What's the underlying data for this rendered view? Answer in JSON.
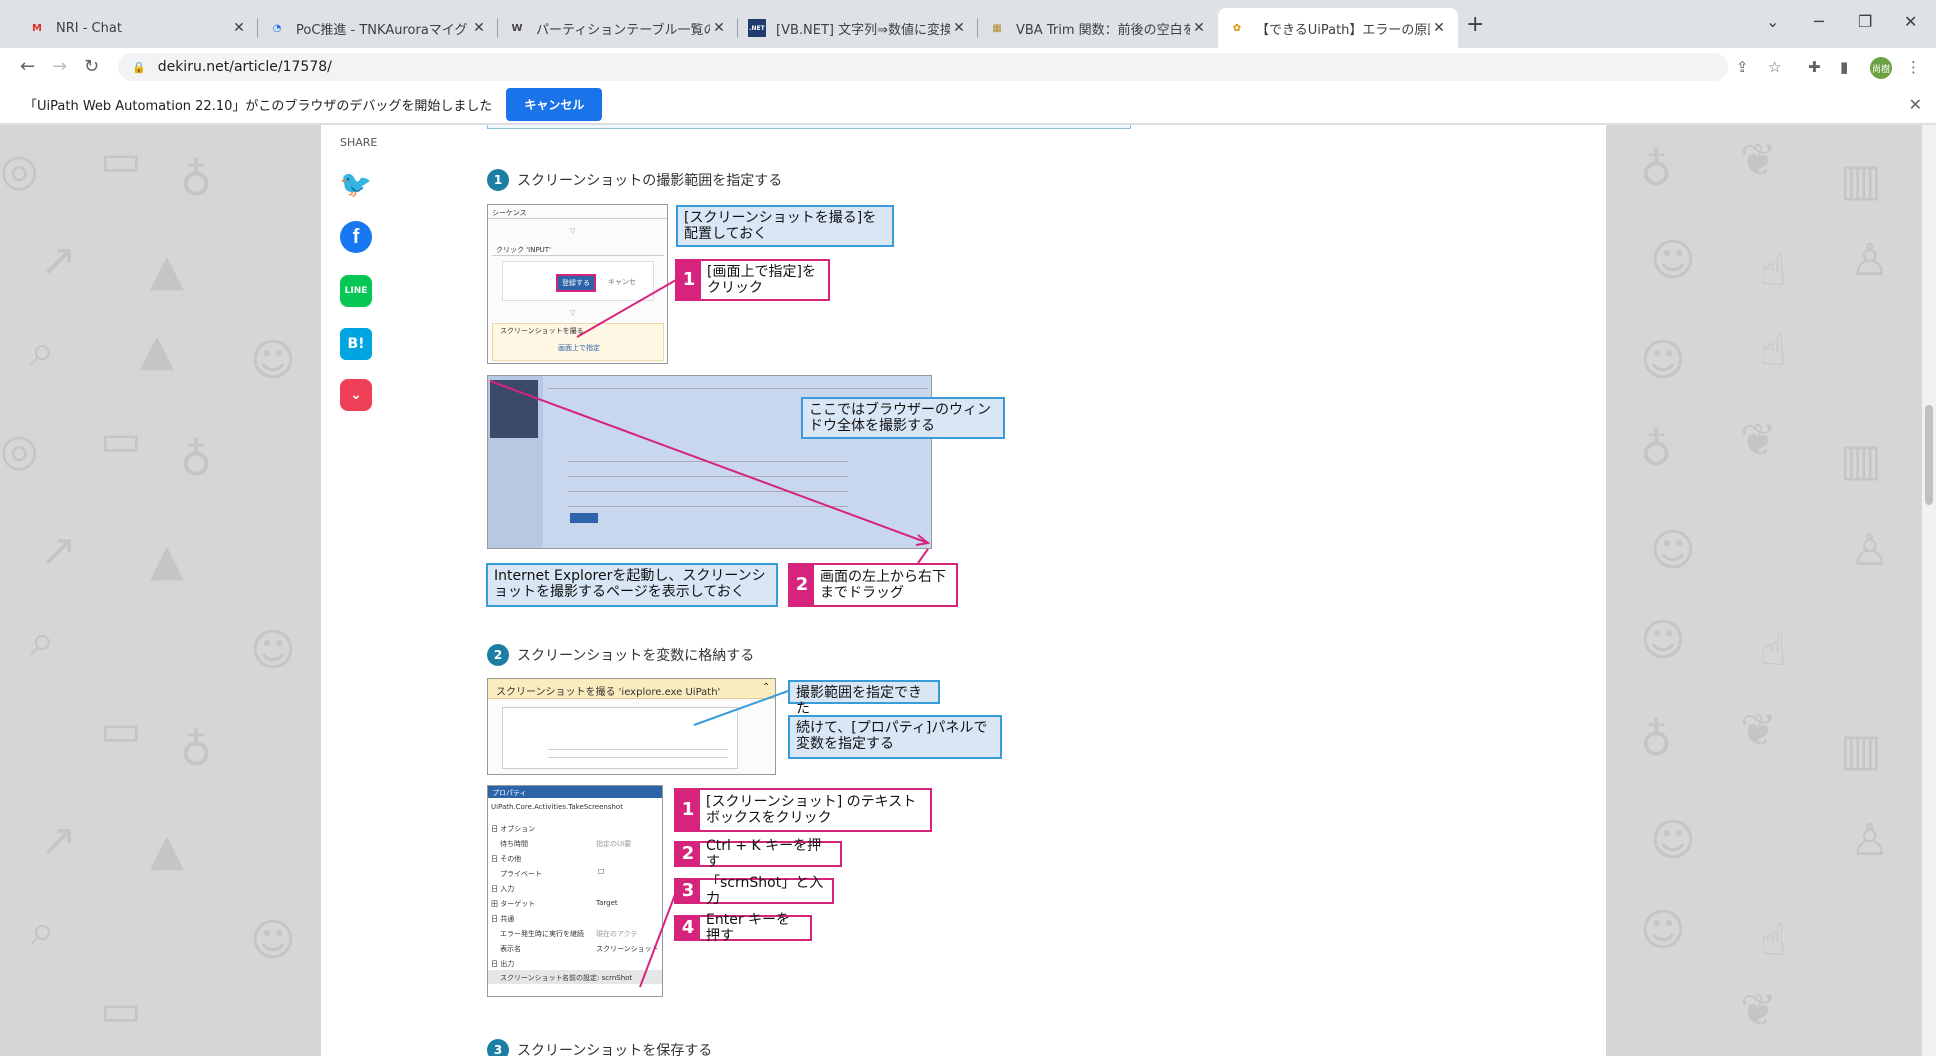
{
  "browser": {
    "tabs": [
      {
        "title": "NRI - Chat",
        "favicon": "M"
      },
      {
        "title": "PoC推進 - TNKAuroraマイグレ Ma",
        "favicon": "◔"
      },
      {
        "title": "パーティションテーブル一覧の確認方法",
        "favicon": "W"
      },
      {
        "title": "[VB.NET] 文字列⇒数値に変換する",
        "favicon": ".NET"
      },
      {
        "title": "VBA Trim 関数：前後の空白を削除",
        "favicon": "▦"
      },
      {
        "title": "【できるUiPath】エラーの原因がわかる",
        "favicon": "✿"
      }
    ],
    "url": "dekiru.net/article/17578/",
    "avatar_label": "尚樹"
  },
  "infobar": {
    "message": "「UiPath Web Automation 22.10」がこのブラウザのデバッグを開始しました",
    "cancel_label": "キャンセル"
  },
  "share": {
    "label": "SHARE",
    "hatena": "B!"
  },
  "step1": {
    "num": "1",
    "title": "スクリーンショットの撮影範囲を指定する",
    "callout_place": "[スクリーンショットを撮る]を配置しておく",
    "click_num": "1",
    "click_text": "[画面上で指定]をクリック",
    "window_note": "ここではブラウザーのウィンドウ全体を撮影する",
    "ie_note": "Internet Explorerを起動し、スクリーンショットを撮影するページを表示しておく",
    "drag_num": "2",
    "drag_text": "画面の左上から右下までドラッグ",
    "shot_sequence": "シーケンス",
    "shot_click": "クリック 'INPUT'",
    "shot_register": "登録する",
    "shot_cancel": "キャンセ",
    "shot_screenshot": "スクリーンショットを撮る",
    "shot_onscreen": "画面上で指定"
  },
  "step2": {
    "num": "2",
    "title": "スクリーンショットを変数に格納する",
    "activity_title": "スクリーンショットを撮る 'iexplore.exe UiPath'",
    "captured": "撮影範囲を指定できた",
    "next_note": "続けて、[プロパティ]パネルで変数を指定する",
    "props_title": "プロパティ",
    "props_class": "UiPath.Core.Activities.TakeScreenshot",
    "props_rows": [
      "日 オプション",
      "待ち時間",
      "日 その他",
      "プライベート",
      "日 入力",
      "田 ターゲット",
      "日 共通",
      "エラー発生時に実行を継続",
      "表示名",
      "日 出力",
      "スクリーンショット"
    ],
    "props_values": [
      "",
      "指定のUI要",
      "",
      "☐",
      "",
      "Target",
      "",
      "現在のアクテ",
      "スクリーンショット",
      "",
      "名前の設定: scrnShot"
    ],
    "callouts": [
      {
        "num": "1",
        "text": "[スクリーンショット] のテキストボックスをクリック"
      },
      {
        "num": "2",
        "text": "Ctrl + K キーを押す"
      },
      {
        "num": "3",
        "text": "「scrnShot」と入力"
      },
      {
        "num": "4",
        "text": "Enter キーを押す"
      }
    ]
  },
  "step3": {
    "num": "3",
    "title": "スクリーンショットを保存する"
  }
}
